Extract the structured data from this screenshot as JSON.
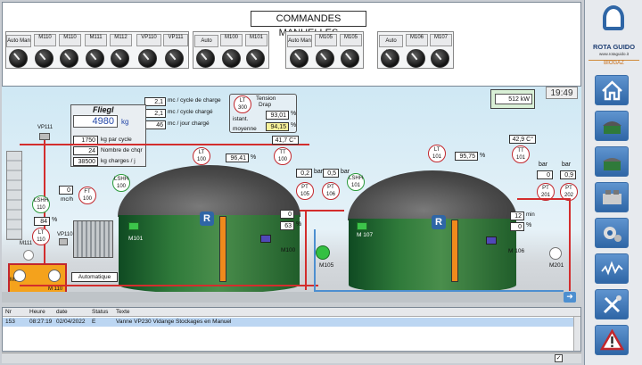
{
  "header": {
    "title": "COMMANDES MANUELLES"
  },
  "groups": [
    {
      "labels": [
        "Auto Man",
        "M110",
        "M110",
        "M111",
        "M112",
        "VP110",
        "VP111"
      ]
    },
    {
      "labels": [
        "Auto Man",
        "M100",
        "M101"
      ]
    },
    {
      "labels": [
        "Auto Man",
        "M105",
        "M105"
      ]
    },
    {
      "labels": [
        "Auto Man",
        "M106",
        "M107"
      ]
    }
  ],
  "knob_sublabels": [
    "0",
    "0",
    "0",
    "0",
    "0",
    "0"
  ],
  "process": {
    "kw_value": "512",
    "kw_unit": "kW",
    "clock": "19:49",
    "charge": [
      {
        "value": "2,1",
        "label": "mc / cycle de charge"
      },
      {
        "value": "2,1",
        "label": "mc / cycle chargé"
      },
      {
        "value": "46",
        "label": "mc / jour chargé"
      }
    ],
    "lt300": {
      "tag": "LT",
      "id": "300",
      "title1": "Tension",
      "title2": "Drap",
      "istant_label": "istant.",
      "istant": "93,01",
      "moyenne_label": "moyenne",
      "moyenne": "94,15",
      "unit": "%"
    },
    "fliegl": {
      "title": "Fliegl",
      "kg": "4980",
      "kg_unit": "kg",
      "rows": [
        {
          "value": "1750",
          "label": "kg par cycle"
        },
        {
          "value": "24",
          "label": "Nombre de chqr"
        },
        {
          "value": "38500",
          "label": "kg charges / j"
        }
      ]
    },
    "vp111": "VP111",
    "ft100": {
      "value": "0",
      "unit": "mc/h",
      "tag": "FT",
      "id": "100"
    },
    "lshh110": {
      "tag": "LSHH",
      "id": "110"
    },
    "lt110": {
      "pct": "84",
      "unit": "%",
      "tag": "LT",
      "id": "110"
    },
    "lshh100": {
      "tag": "LSHH",
      "id": "100"
    },
    "m111": "M111",
    "m112": "M112",
    "m110": "M 110",
    "vp110": "VP110",
    "auto_label": "Automatique",
    "tank1": {
      "lt": "100",
      "lt_tag": "LT",
      "level": "96,41",
      "tt_tag": "TT",
      "tt": "100",
      "temp": "41,7",
      "temp_unit": "C°",
      "pt_tag": "PT",
      "pt1": "105",
      "pt2": "106",
      "bar1": "0,2",
      "bar2": "0,5",
      "bar_unit": "bar",
      "motor": "M101",
      "pump": "M100",
      "m100_val": "0",
      "m100_pct": "63",
      "m105": "M105",
      "lshh": "101",
      "lshh_tag": "LSHH"
    },
    "tank2": {
      "lt": "101",
      "lt_tag": "LT",
      "level": "95,75",
      "tt_tag": "TT",
      "tt": "101",
      "temp": "42,9",
      "temp_unit": "C°",
      "pt_tag": "PT",
      "pt1": "201",
      "pt2": "202",
      "bar1": "0",
      "bar2": "0,9",
      "bar_unit": "bar",
      "motor": "M 107",
      "pump": "M 106",
      "m106_val": "12",
      "m106_unit": "min",
      "m106_pct": "0",
      "m201": "M201"
    },
    "pct_unit": "%"
  },
  "log": {
    "columns": [
      "Nr",
      "Heure",
      "date",
      "Status",
      "Texte"
    ],
    "rows": [
      {
        "nr": "153",
        "heure": "08:27:19",
        "date": "02/04/2022",
        "status": "E",
        "text": "Vanne VP230 Vidange Stockages en Manuel"
      }
    ]
  },
  "sidebar": {
    "brand": "ROTA GUIDO",
    "url": "www.rotaguido.it",
    "sub": "BIOGAZ",
    "buttons": [
      "home-icon",
      "digester-icon",
      "storage-tank-icon",
      "generator-icon",
      "settings-icon",
      "trend-icon",
      "tools-icon",
      "alarm-icon"
    ]
  },
  "colors": {
    "accent": "#2f66a6",
    "alarm_red": "#c2272d",
    "highlight": "#f7f29a",
    "tank_green": "#2f7a3a"
  }
}
